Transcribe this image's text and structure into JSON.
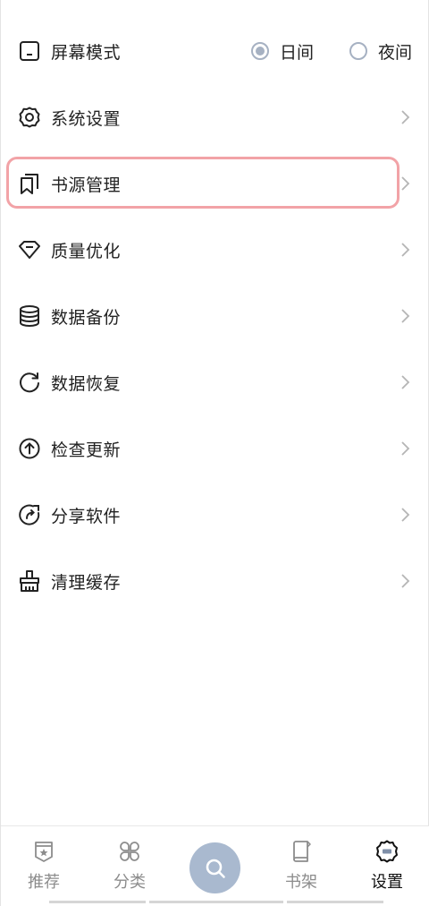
{
  "screen_mode": {
    "label": "屏幕模式",
    "icon": "screen-icon",
    "options": [
      {
        "label": "日间",
        "checked": true
      },
      {
        "label": "夜间",
        "checked": false
      }
    ]
  },
  "menu": [
    {
      "label": "系统设置",
      "icon": "gear-icon"
    },
    {
      "label": "书源管理",
      "icon": "bookmark-icon",
      "highlighted": true
    },
    {
      "label": "质量优化",
      "icon": "diamond-icon"
    },
    {
      "label": "数据备份",
      "icon": "database-icon"
    },
    {
      "label": "数据恢复",
      "icon": "refresh-icon"
    },
    {
      "label": "检查更新",
      "icon": "upload-circle-icon"
    },
    {
      "label": "分享软件",
      "icon": "share-circle-icon"
    },
    {
      "label": "清理缓存",
      "icon": "broom-icon"
    }
  ],
  "tabbar": {
    "items": [
      {
        "label": "推荐",
        "icon": "badge-star-icon",
        "active": false
      },
      {
        "label": "分类",
        "icon": "clover-grid-icon",
        "active": false
      },
      {
        "label": "书架",
        "icon": "book-icon",
        "active": false
      },
      {
        "label": "设置",
        "icon": "settings-gear-icon",
        "active": true
      }
    ],
    "search_icon": "search-icon"
  },
  "colors": {
    "accent": "#a9b9cf",
    "highlight": "#f2a3a7",
    "text": "#222222",
    "muted": "#8c8c8c"
  }
}
